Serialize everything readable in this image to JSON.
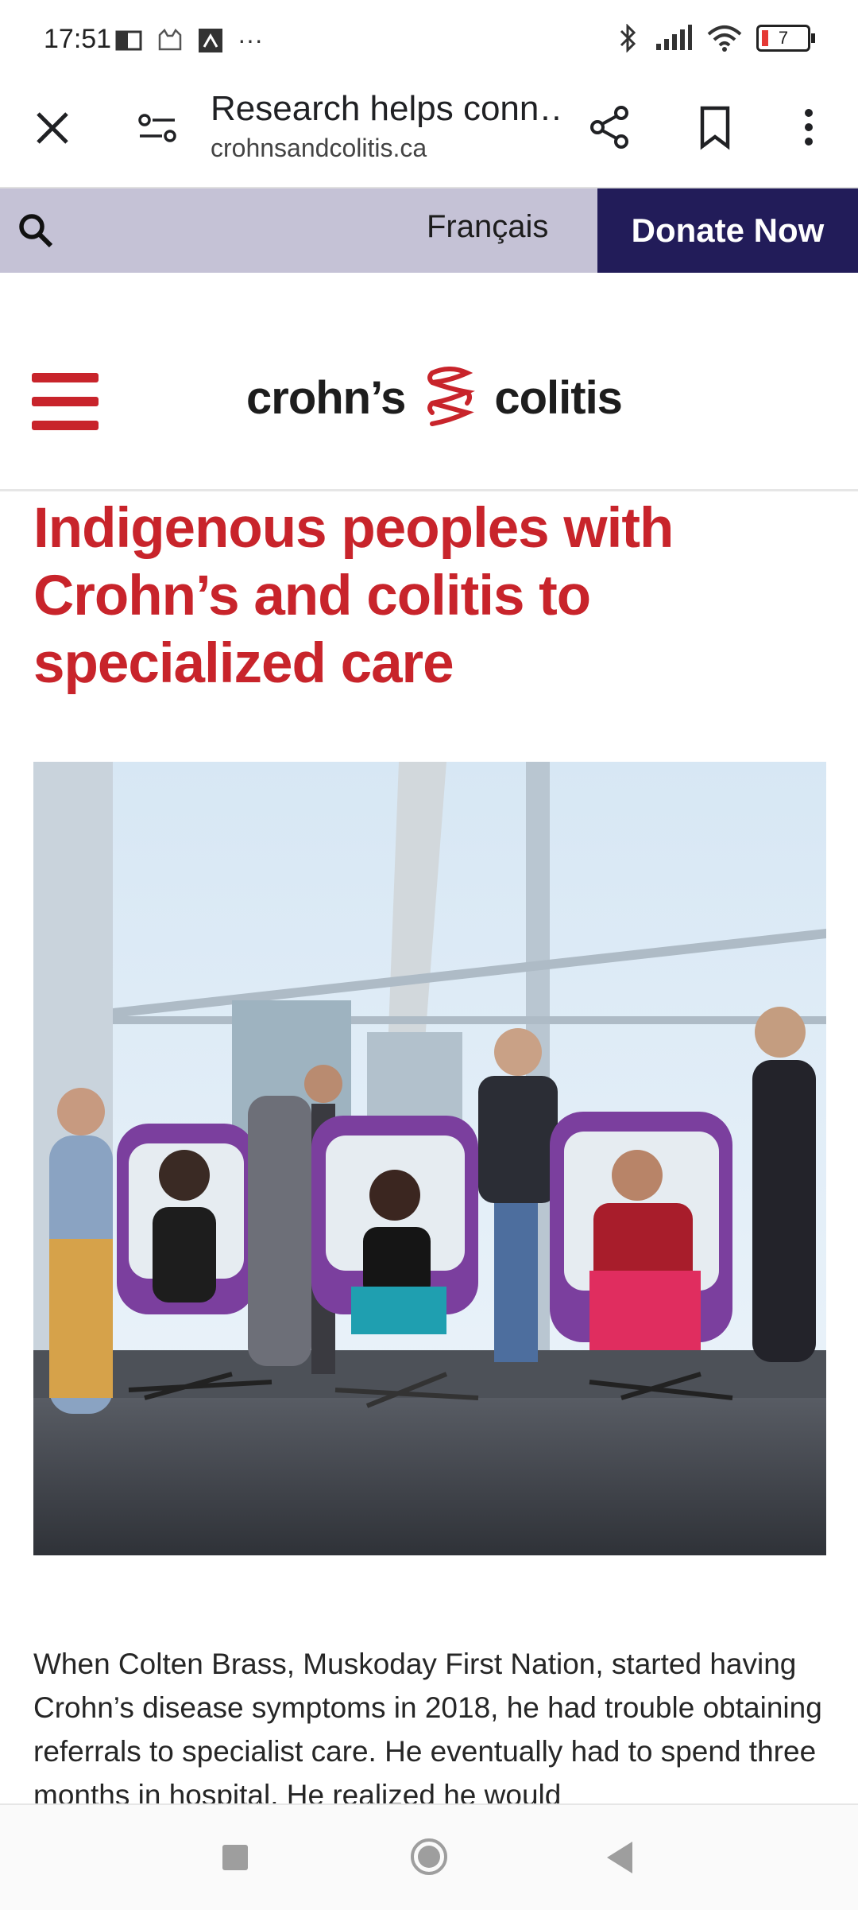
{
  "status_bar": {
    "time": "17:51",
    "dots": "···",
    "battery_level": "7"
  },
  "browser": {
    "tab_title": "Research helps conn…",
    "url": "crohnsandcolitis.ca"
  },
  "utility": {
    "language_link": "Français",
    "donate_label": "Donate Now"
  },
  "logo": {
    "left_text": "crohn’s",
    "right_text": "colitis"
  },
  "article": {
    "headline": "Indigenous peoples with Crohn’s and colitis to specialized care",
    "body": "When Colten Brass, Muskoday First Nation, started having Crohn’s disease symptoms in 2018, he had trouble obtaining referrals to specialist care. He eventually had to spend three months in hospital. He realized he would"
  },
  "colors": {
    "brand_red": "#c8242b",
    "donate_bg": "#221c59",
    "utility_bg": "#c5c2d6"
  }
}
